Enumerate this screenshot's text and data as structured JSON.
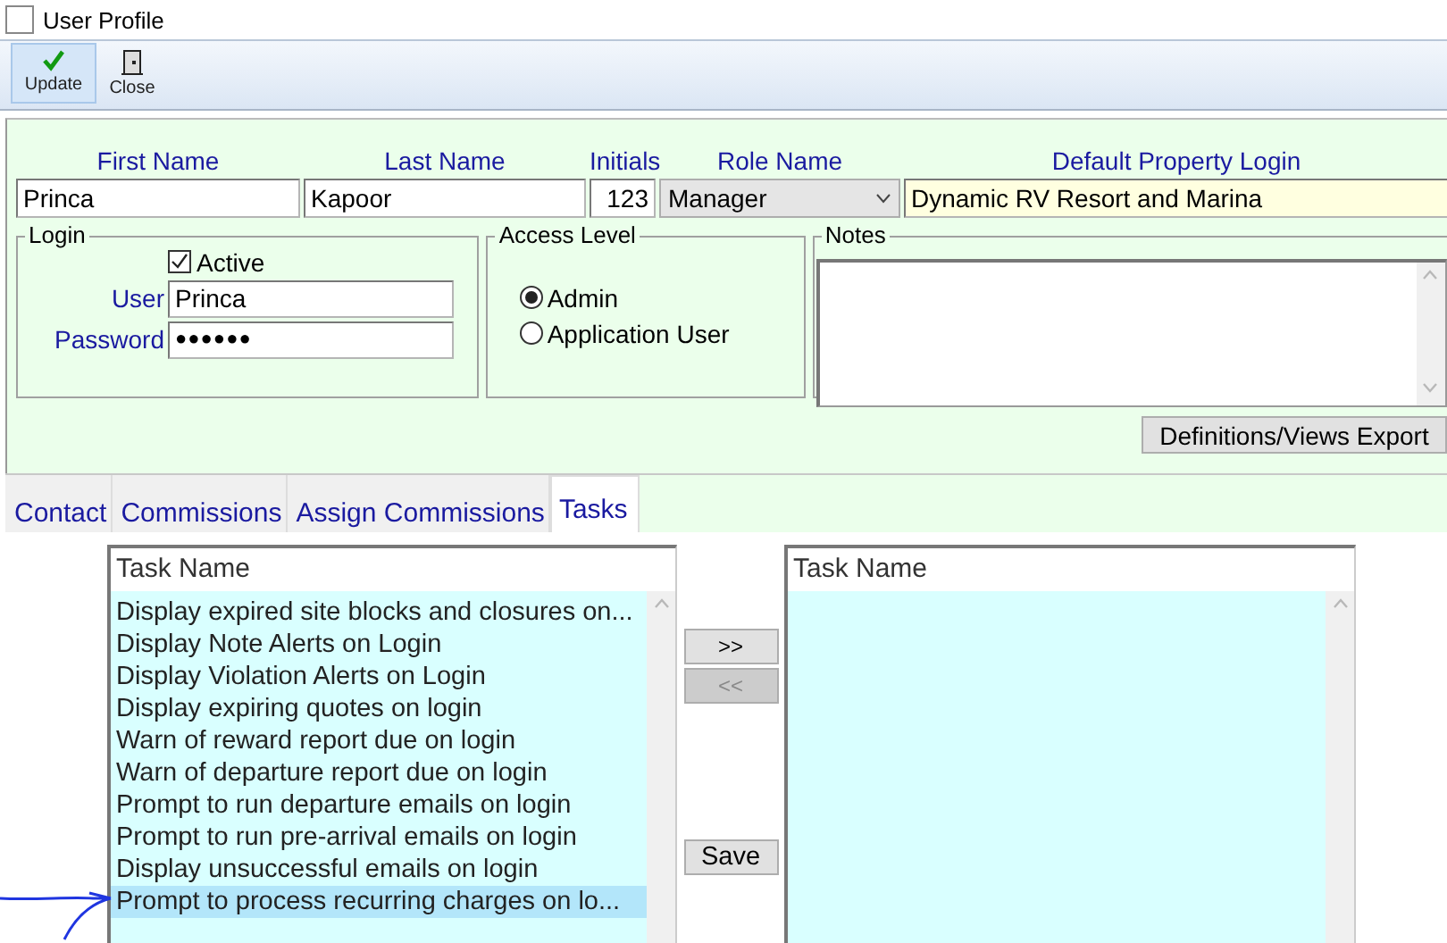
{
  "window": {
    "title": "User Profile"
  },
  "toolbar": [
    {
      "label": "Update",
      "kind": "check",
      "selected": true
    },
    {
      "label": "Close",
      "kind": "door",
      "selected": false
    }
  ],
  "fields": [
    {
      "label": "First Name",
      "value": "Princa",
      "kind": "text"
    },
    {
      "label": "Last Name",
      "value": "Kapoor",
      "kind": "text"
    },
    {
      "label": "Initials",
      "value": "123",
      "kind": "number"
    },
    {
      "label": "Role Name",
      "value": "Manager",
      "kind": "select"
    },
    {
      "label": "Default Property Login",
      "value": "Dynamic RV Resort and Marina",
      "kind": "lookup"
    }
  ],
  "login": {
    "title": "Login",
    "active": {
      "label": "Active",
      "checked": true
    },
    "user": {
      "label": "User",
      "value": "Princa"
    },
    "password": {
      "label": "Password",
      "value": "●●●●●●"
    }
  },
  "access_level": {
    "title": "Access Level",
    "options": [
      {
        "label": "Admin",
        "selected": true
      },
      {
        "label": "Application User",
        "selected": false
      }
    ]
  },
  "notes": {
    "title": "Notes"
  },
  "export_button": "Definitions/Views Export",
  "tabs": [
    {
      "label": "Contact",
      "selected": false
    },
    {
      "label": "Commissions",
      "selected": false
    },
    {
      "label": "Assign Commissions",
      "selected": false
    },
    {
      "label": "Tasks",
      "selected": true
    }
  ],
  "tasks": {
    "available": {
      "header": "Task Name",
      "rows": [
        {
          "label": "Display expired site blocks and closures on...",
          "selected": false
        },
        {
          "label": "Display Note Alerts on Login",
          "selected": false
        },
        {
          "label": "Display Violation Alerts on Login",
          "selected": false
        },
        {
          "label": "Display expiring quotes on login",
          "selected": false
        },
        {
          "label": "Warn of reward report due on login",
          "selected": false
        },
        {
          "label": "Warn of departure report due on login",
          "selected": false
        },
        {
          "label": "Prompt to run departure emails on login",
          "selected": false
        },
        {
          "label": "Prompt to run pre-arrival emails on login",
          "selected": false
        },
        {
          "label": "Display unsuccessful emails on login",
          "selected": false
        },
        {
          "label": "Prompt to process recurring charges on lo...",
          "selected": true
        }
      ]
    },
    "move_buttons": [
      {
        "label": ">>",
        "disabled": false
      },
      {
        "label": "<<",
        "disabled": true
      }
    ],
    "save_button": "Save",
    "assigned": {
      "header": "Task Name"
    }
  },
  "annotation": {
    "kind": "arrow"
  }
}
